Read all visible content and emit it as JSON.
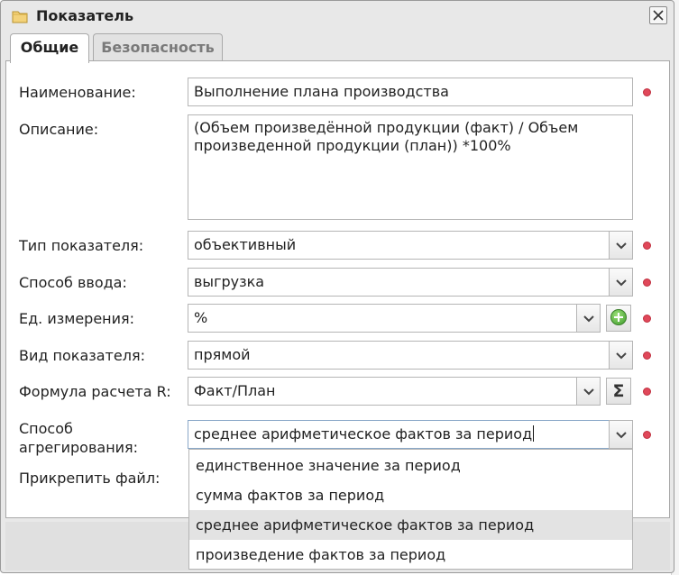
{
  "window": {
    "title": "Показатель",
    "title_icon": "folder-icon",
    "close_icon": "close-icon"
  },
  "tabs": [
    {
      "label": "Общие",
      "active": true
    },
    {
      "label": "Безопасность",
      "active": false
    }
  ],
  "form": {
    "name": {
      "label": "Наименование:",
      "value": "Выполнение плана производства"
    },
    "description": {
      "label": "Описание:",
      "value": "(Объем произведённой продукции (факт) / Объем произведенной продукции (план)) *100%"
    },
    "indicator_type": {
      "label": "Тип показателя:",
      "value": "объективный"
    },
    "input_method": {
      "label": "Способ ввода:",
      "value": "выгрузка"
    },
    "unit": {
      "label": "Ед. измерения:",
      "value": "%"
    },
    "indicator_kind": {
      "label": "Вид показателя:",
      "value": "прямой"
    },
    "formula": {
      "label": "Формула расчета R:",
      "value": "Факт/План"
    },
    "aggregation": {
      "label_line1": "Способ",
      "label_line2": "агрегирования:",
      "value": "среднее арифметическое фактов за период",
      "options": [
        "единственное значение за период",
        "сумма фактов за период",
        "среднее арифметическое фактов за период",
        "произведение фактов за период"
      ],
      "selected_index": 2
    },
    "attach": {
      "label": "Прикрепить файл:"
    }
  },
  "colors": {
    "required_marker": "#e0485a",
    "add_button": "#3c9a2a",
    "selected_option": "#e3e3e3"
  }
}
